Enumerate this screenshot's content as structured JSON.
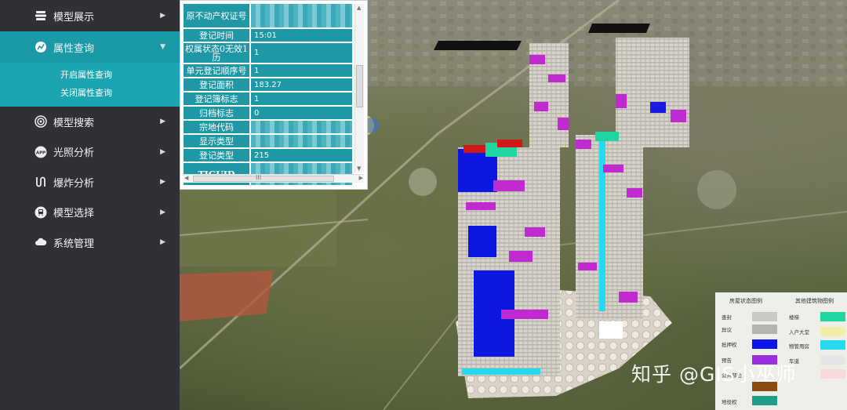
{
  "sidebar": {
    "items": [
      {
        "label": "模型展示"
      },
      {
        "label": "属性查询"
      },
      {
        "label": "模型搜索"
      },
      {
        "label": "光照分析"
      },
      {
        "label": "爆炸分析"
      },
      {
        "label": "模型选择"
      },
      {
        "label": "系统管理"
      }
    ],
    "submenu": [
      {
        "label": "开启属性查询"
      },
      {
        "label": "关闭属性查询"
      }
    ]
  },
  "attributes": [
    {
      "key": "原不动产权证号",
      "value": ""
    },
    {
      "key": "登记时间",
      "value": "15:01"
    },
    {
      "key": "权属状态0无效1历",
      "value": "1"
    },
    {
      "key": "单元登记顺序号",
      "value": "1"
    },
    {
      "key": "登记面积",
      "value": "183.27"
    },
    {
      "key": "登记簿标志",
      "value": "1"
    },
    {
      "key": "归档标志",
      "value": "0"
    },
    {
      "key": "宗地代码",
      "value": ""
    },
    {
      "key": "显示类型",
      "value": ""
    },
    {
      "key": "登记类型",
      "value": "215"
    },
    {
      "key": "TIGUID",
      "value": ""
    }
  ],
  "scrollbar": {
    "grip": "III"
  },
  "legend": {
    "header_left": "房屋状态图例",
    "header_right": "其他建筑物图例",
    "left": [
      {
        "label": "查封",
        "color": "#c9c9c9"
      },
      {
        "label": "异议",
        "color": "#b3b3b3"
      },
      {
        "label": "抵押权",
        "color": "#0b17e8"
      },
      {
        "label": "预告",
        "color": "#9b2ee0"
      },
      {
        "label": "公共部位",
        "color": "#8a4a10"
      },
      {
        "label": "地役权",
        "color": "#1f9e8e"
      }
    ],
    "right": [
      {
        "label": "楼梯",
        "color": "#1fd6a0"
      },
      {
        "label": "入户大堂",
        "color": "#f2f0a8"
      },
      {
        "label": "物管用房",
        "color": "#25d9f0"
      },
      {
        "label": "车道",
        "color": "#e6e6e6"
      },
      {
        "label": "",
        "color": "#f8d9dc"
      }
    ]
  },
  "watermark": "知乎 @GIS小巫师",
  "colors": {
    "sidebar_bg": "#2f3137",
    "accent": "#1a9aa6",
    "table_cell": "#1f97a5"
  }
}
